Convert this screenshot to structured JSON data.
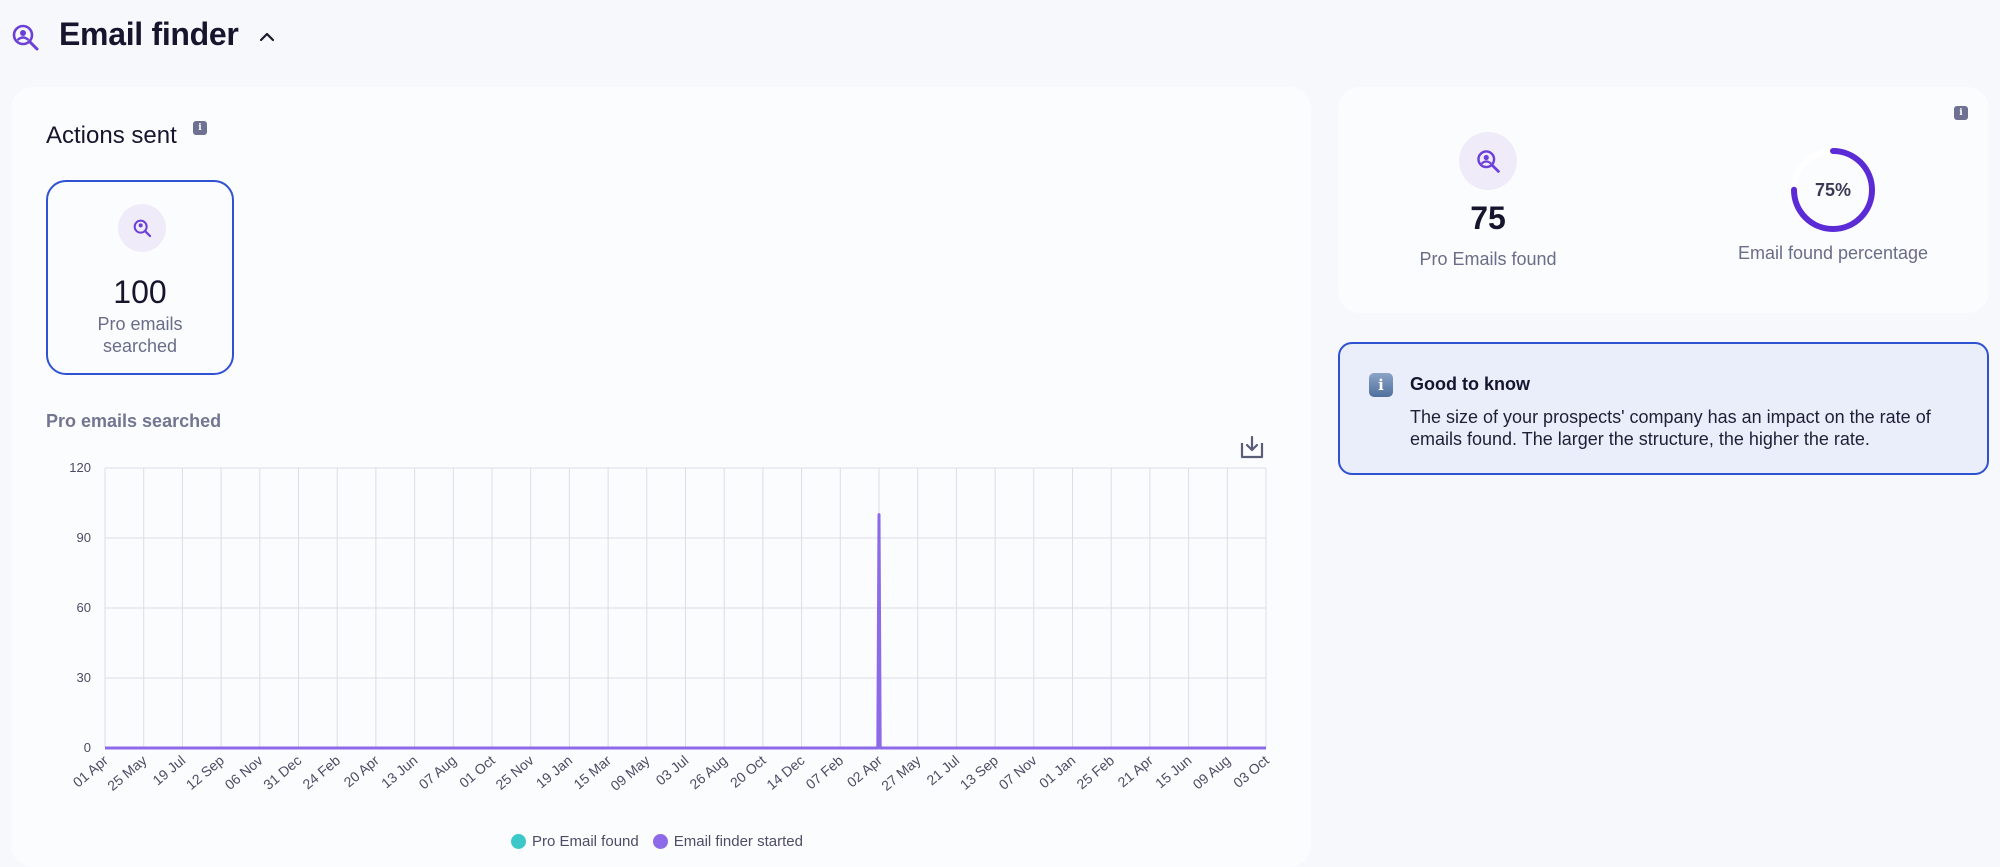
{
  "header": {
    "title": "Email finder",
    "icon": "user-search-icon",
    "toggle_icon": "chevron-up-icon"
  },
  "actions": {
    "title": "Actions sent",
    "info_badge": "i",
    "tile": {
      "value": "100",
      "label": "Pro emails searched",
      "icon": "user-search-icon"
    }
  },
  "chart": {
    "title": "Pro emails searched",
    "download_icon": "download-icon",
    "legend": [
      {
        "label": "Pro Email found",
        "color": "#3cc7c9"
      },
      {
        "label": "Email finder started",
        "color": "#8d6be8"
      }
    ]
  },
  "chart_data": {
    "type": "line",
    "title": "Pro emails searched",
    "xlabel": "",
    "ylabel": "",
    "ylim": [
      0,
      120
    ],
    "yticks": [
      0,
      30,
      60,
      90,
      120
    ],
    "grid": true,
    "legend_position": "bottom",
    "categories": [
      "01 Apr",
      "25 May",
      "19 Jul",
      "12 Sep",
      "06 Nov",
      "31 Dec",
      "24 Feb",
      "20 Apr",
      "13 Jun",
      "07 Aug",
      "01 Oct",
      "25 Nov",
      "19 Jan",
      "15 Mar",
      "09 May",
      "03 Jul",
      "26 Aug",
      "20 Oct",
      "14 Dec",
      "07 Feb",
      "02 Apr",
      "27 May",
      "21 Jul",
      "13 Sep",
      "07 Nov",
      "01 Jan",
      "25 Feb",
      "21 Apr",
      "15 Jun",
      "09 Aug",
      "03 Oct"
    ],
    "series": [
      {
        "name": "Pro Email found",
        "color": "#3cc7c9",
        "peak_at": "02 Apr",
        "peak_value": 0
      },
      {
        "name": "Email finder started",
        "color": "#8d6be8",
        "peak_at": "02 Apr",
        "peak_value": 100
      }
    ]
  },
  "summary": {
    "info_badge": "i",
    "found": {
      "value": "75",
      "label": "Pro Emails found",
      "icon": "user-search-icon"
    },
    "percentage": {
      "value": 75,
      "display": "75%",
      "label": "Email found percentage",
      "color": "#5b2bd6"
    }
  },
  "good_to_know": {
    "title": "Good to know",
    "icon_glyph": "i",
    "text": "The size of your prospects' company has an impact on the rate of emails found. The larger the structure, the higher the rate."
  }
}
